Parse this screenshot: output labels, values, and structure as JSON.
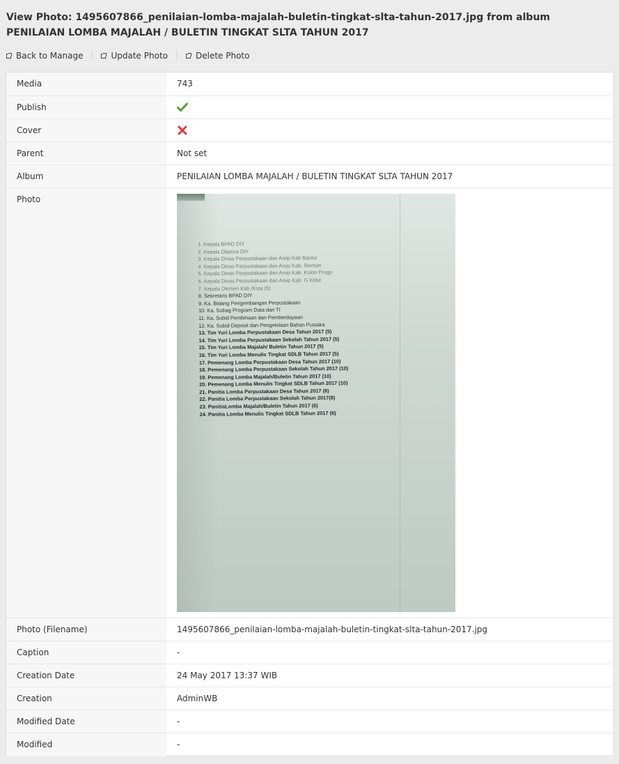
{
  "page": {
    "title": "View Photo: 1495607866_penilaian-lomba-majalah-buletin-tingkat-slta-tahun-2017.jpg from album PENILAIAN LOMBA MAJALAH / BULETIN TINGKAT SLTA TAHUN 2017"
  },
  "toolbar": {
    "back_label": "Back to Manage",
    "update_label": "Update Photo",
    "delete_label": "Delete Photo"
  },
  "details": {
    "media": {
      "label": "Media",
      "value": "743"
    },
    "publish": {
      "label": "Publish",
      "value_icon": "check-icon",
      "color": "#4aa02c"
    },
    "cover": {
      "label": "Cover",
      "value_icon": "cross-icon",
      "color": "#e0383e"
    },
    "parent": {
      "label": "Parent",
      "value": "Not set"
    },
    "album": {
      "label": "Album",
      "value": "PENILAIAN LOMBA MAJALAH / BULETIN TINGKAT SLTA TAHUN 2017"
    },
    "photo": {
      "label": "Photo"
    },
    "filename": {
      "label": "Photo (Filename)",
      "value": "1495607866_penilaian-lomba-majalah-buletin-tingkat-slta-tahun-2017.jpg"
    },
    "caption": {
      "label": "Caption",
      "value": "-"
    },
    "creation_date": {
      "label": "Creation Date",
      "value": "24 May 2017 13:37 WIB"
    },
    "creation": {
      "label": "Creation",
      "value": "AdminWB"
    },
    "modified_date": {
      "label": "Modified Date",
      "value": "-"
    },
    "modified": {
      "label": "Modified",
      "value": "-"
    }
  },
  "photo_document": {
    "lines": [
      "1.   Kepala BPAD DIY",
      "2.   Kepala Dikpora DIY",
      "3.   Kepala Dinas Perpustakaan dan Arsip Kab Bantul",
      "4.   Kepala Dinas Perpustakaan dan Arsip Kab. Sleman",
      "5.   Kepala Dinas Perpustakaan dan Arsip Kab. Kulon Progo",
      "6.   Kepala Dinas Perpustakaan dan Arsip Kab. G Kidul",
      "7.   Kepala Dikmen Kab /Kota (5)",
      "8.   Sekretaris BPAD DIY",
      "9.   Ka. Bidang Pengembangan Perpustakaan",
      "10. Ka. Subag Program Data dan TI",
      "11. Ka. Subid Pembinaan dan Pemberdayaan",
      "12. Ka. Subid Deposit dan Pengelolaan Bahan Pustaka",
      "13. Tim Yuri Lomba Perpustakaan Desa Tahun 2017 (5)",
      "14. Tim Yuri Lomba Perpustakaan Sekolah Tahun 2017 (5)",
      "15. Tim Yuri Lomba Majalah/ Buletin Tahun 2017 (5)",
      "16. Tim Yuri Lomba Menulis Tingkat SDLB Tahun 2017 (5)",
      "17. Pemenang  Lomba Perpustakaan Desa Tahun 2017 (10)",
      "18. Pemenang  Lomba Perpustakaan Sekolah Tahun 2017 (10)",
      "19. Pemenang Lomba Majalah/Buletin Tahun 2017 (10)",
      "20. Pemenang Lomba Menulis Tingkat SDLB Tahun 2017 (10)",
      "21. Panitia Lomba Perpustakaan Desa Tahun 2017 (8)",
      "22. Panitia Lomba Perpustakaan Sekolah Tahun 2017(8)",
      "23. PanitiaLomba Majalah/Buletin Tahun 2017 (6)",
      "24. Panitia Lomba Menulis Tingkat SDLB Tahun 2017 (6)"
    ]
  }
}
